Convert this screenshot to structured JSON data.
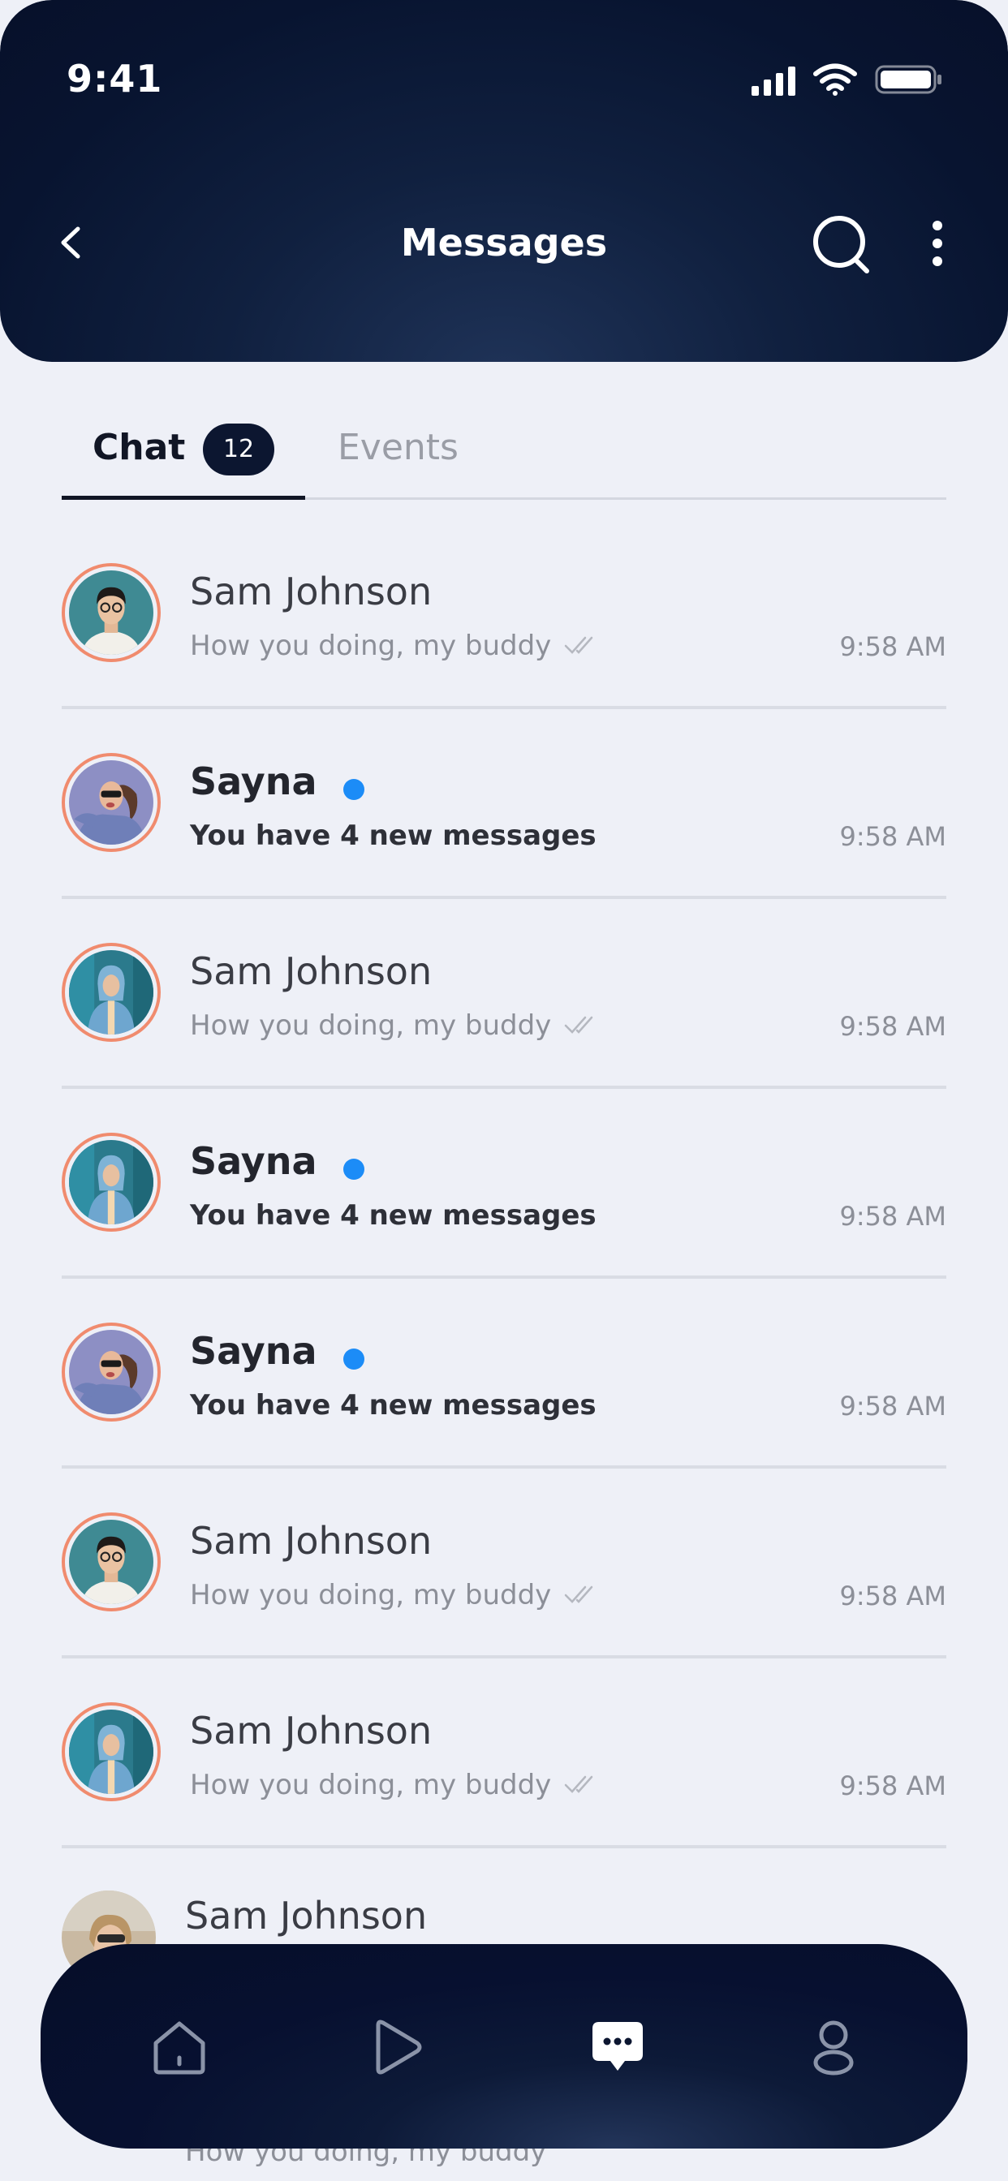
{
  "status_bar": {
    "time": "9:41"
  },
  "header": {
    "title": "Messages"
  },
  "tabs": {
    "chat_label": "Chat",
    "chat_count": "12",
    "events_label": "Events"
  },
  "chats": [
    {
      "name": "Sam Johnson",
      "preview": "How you doing, my buddy",
      "time": "9:58 AM",
      "unread": false,
      "avatar": "man-portrait"
    },
    {
      "name": "Sayna",
      "preview": "You have 4 new messages",
      "time": "9:58 AM",
      "unread": true,
      "avatar": "woman-sunglasses"
    },
    {
      "name": "Sam Johnson",
      "preview": "How you doing, my buddy",
      "time": "9:58 AM",
      "unread": false,
      "avatar": "person-blue-hoodie"
    },
    {
      "name": "Sayna",
      "preview": "You have 4 new messages",
      "time": "9:58 AM",
      "unread": true,
      "avatar": "person-blue-hoodie"
    },
    {
      "name": "Sayna",
      "preview": "You have 4 new messages",
      "time": "9:58 AM",
      "unread": true,
      "avatar": "woman-sunglasses"
    },
    {
      "name": "Sam Johnson",
      "preview": "How you doing, my buddy",
      "time": "9:58 AM",
      "unread": false,
      "avatar": "man-portrait"
    },
    {
      "name": "Sam Johnson",
      "preview": "How you doing, my buddy",
      "time": "9:58 AM",
      "unread": false,
      "avatar": "person-blue-hoodie"
    }
  ],
  "partial_chat": {
    "name": "Sam Johnson",
    "preview": "How you doing, my buddy"
  },
  "bottom_nav": {
    "items": [
      {
        "icon": "home-icon"
      },
      {
        "icon": "play-icon"
      },
      {
        "icon": "chat-bubble-icon",
        "active": true
      },
      {
        "icon": "profile-icon"
      }
    ]
  },
  "colors": {
    "accent_dark": "#0c1630",
    "unread_dot": "#1c8cf7",
    "avatar_ring": "#f08b6e",
    "background": "#eef0f7"
  }
}
